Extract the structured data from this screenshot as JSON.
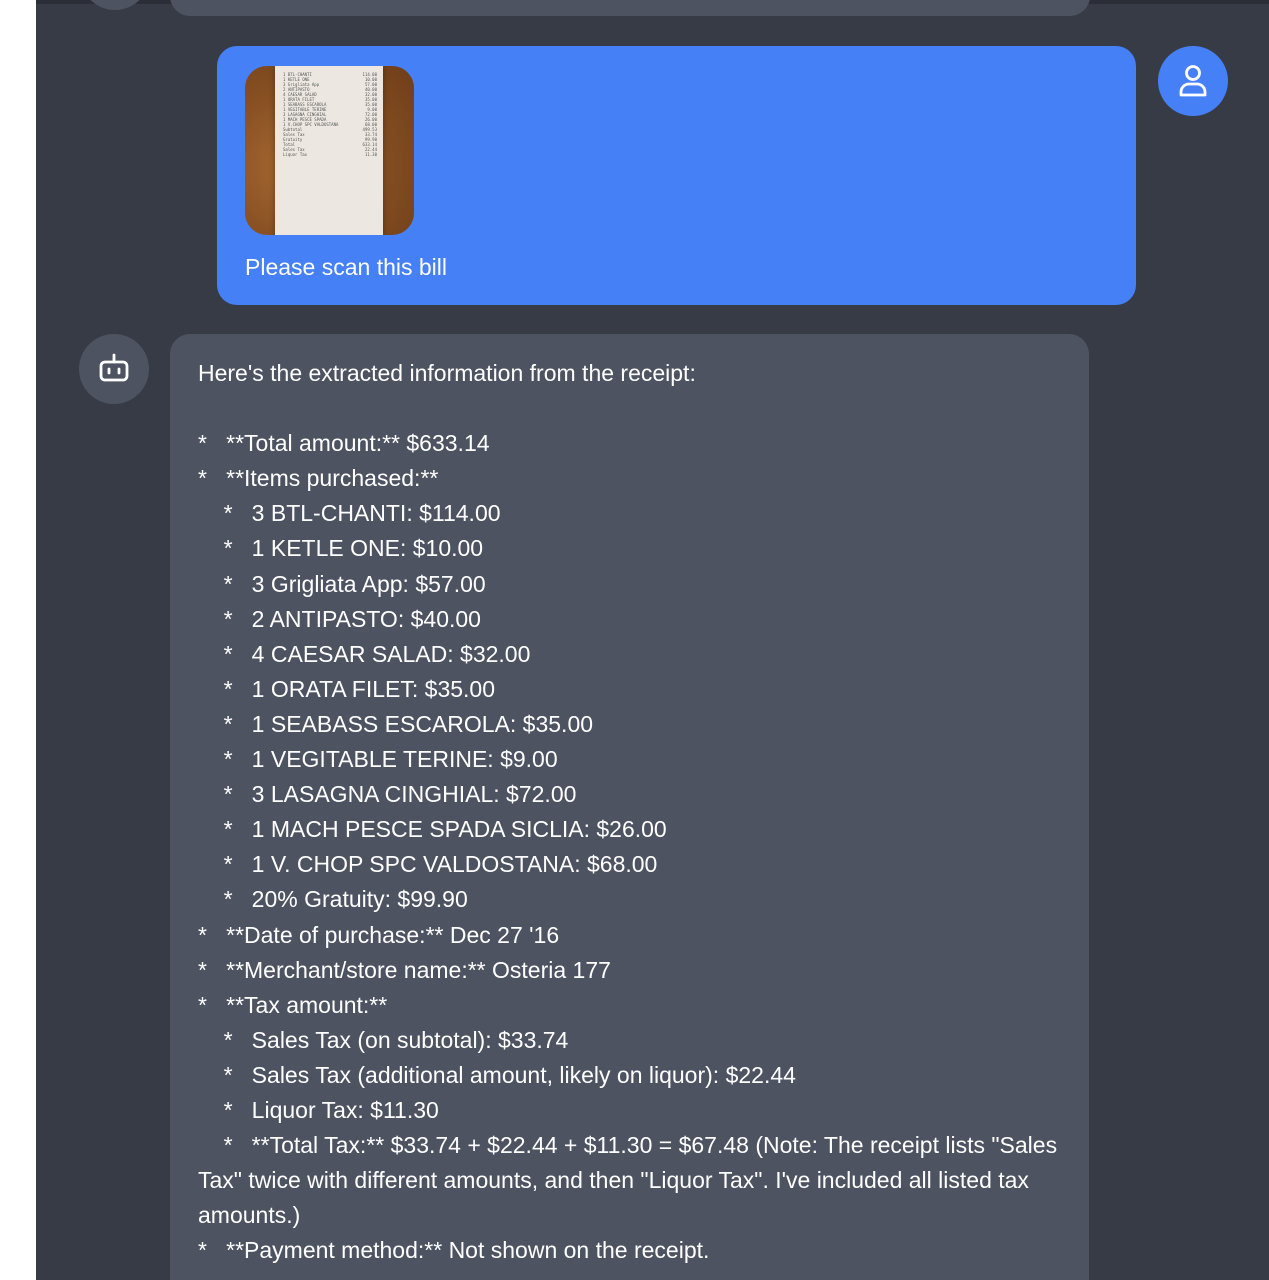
{
  "user_message": {
    "text": "Please scan this bill",
    "attachment_icon": "receipt-photo",
    "receipt_preview": [
      {
        "label": "1 BTL-CHANTI",
        "value": "114.00"
      },
      {
        "label": "1 KETLE ONE",
        "value": "10.00"
      },
      {
        "label": "3 Grigliata App",
        "value": "57.00"
      },
      {
        "label": "2 ANTIPASTO",
        "value": "40.00"
      },
      {
        "label": "4 CAESAR SALAD",
        "value": "32.00"
      },
      {
        "label": "1 ORATA FILET",
        "value": "35.00"
      },
      {
        "label": "1 SEABASS ESCAROLA",
        "value": "35.00"
      },
      {
        "label": "1 VEGITABLE TERINE",
        "value": "9.00"
      },
      {
        "label": "3 LASAGNA CINGHIAL",
        "value": "72.00"
      },
      {
        "label": "1 MACH PESCE SPADA",
        "value": "26.00"
      },
      {
        "label": "1 V.CHOP SPC VALDOSTANA",
        "value": "68.00"
      },
      {
        "label": "Subtotal",
        "value": "499.53"
      },
      {
        "label": "Sales Tax",
        "value": "33.74"
      },
      {
        "label": "Gratuity",
        "value": "99.90"
      },
      {
        "label": "Total",
        "value": "633.14"
      },
      {
        "label": "Sales Tax",
        "value": "22.44"
      },
      {
        "label": "Liquor Tax",
        "value": "11.30"
      }
    ]
  },
  "bot_message": {
    "text": "Here's the extracted information from the receipt:\n\n*   **Total amount:** $633.14\n*   **Items purchased:**\n    *   3 BTL-CHANTI: $114.00\n    *   1 KETLE ONE: $10.00\n    *   3 Grigliata App: $57.00\n    *   2 ANTIPASTO: $40.00\n    *   4 CAESAR SALAD: $32.00\n    *   1 ORATA FILET: $35.00\n    *   1 SEABASS ESCAROLA: $35.00\n    *   1 VEGITABLE TERINE: $9.00\n    *   3 LASAGNA CINGHIAL: $72.00\n    *   1 MACH PESCE SPADA SICLIA: $26.00\n    *   1 V. CHOP SPC VALDOSTANA: $68.00\n    *   20% Gratuity: $99.90\n*   **Date of purchase:** Dec 27 '16\n*   **Merchant/store name:** Osteria 177\n*   **Tax amount:**\n    *   Sales Tax (on subtotal): $33.74\n    *   Sales Tax (additional amount, likely on liquor): $22.44\n    *   Liquor Tax: $11.30\n    *   **Total Tax:** $33.74 + $22.44 + $11.30 = $67.48 (Note: The receipt lists \"Sales Tax\" twice with different amounts, and then \"Liquor Tax\". I've included all listed tax amounts.)\n*   **Payment method:** Not shown on the receipt."
  },
  "icons": {
    "user_avatar": "user-icon",
    "bot_avatar": "robot-icon"
  },
  "colors": {
    "chat_background": "#373b46",
    "user_bubble": "#4680f6",
    "bot_bubble": "#4e5361",
    "text": "#ffffff"
  }
}
